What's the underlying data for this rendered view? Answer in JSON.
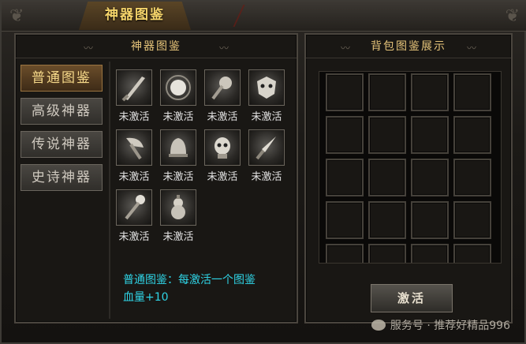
{
  "window": {
    "title": "神器图鉴"
  },
  "left_panel": {
    "title": "神器图鉴",
    "tabs": [
      {
        "label": "普通图鉴",
        "active": true
      },
      {
        "label": "高级神器",
        "active": false
      },
      {
        "label": "传说神器",
        "active": false
      },
      {
        "label": "史诗神器",
        "active": false
      }
    ],
    "artifacts": [
      {
        "icon": "blade-icon",
        "status": "未激活"
      },
      {
        "icon": "orb-icon",
        "status": "未激活"
      },
      {
        "icon": "mace-icon",
        "status": "未激活"
      },
      {
        "icon": "demon-mask-icon",
        "status": "未激活"
      },
      {
        "icon": "axe-icon",
        "status": "未激活"
      },
      {
        "icon": "bell-icon",
        "status": "未激活"
      },
      {
        "icon": "skull-idol-icon",
        "status": "未激活"
      },
      {
        "icon": "dagger-icon",
        "status": "未激活"
      },
      {
        "icon": "staff-icon",
        "status": "未激活"
      },
      {
        "icon": "gourd-icon",
        "status": "未激活"
      }
    ],
    "description_line1": "普通图鉴：每激活一个图鉴",
    "description_line2": "血量+10"
  },
  "right_panel": {
    "title": "背包图鉴展示",
    "bag_slots": 20,
    "activate_label": "激活"
  },
  "watermark": {
    "text": "服务号 · 推荐好精品996"
  },
  "colors": {
    "accent_gold": "#e6c47a",
    "desc_cyan": "#2fd4e6",
    "active_tab": "#6a4d2a"
  }
}
